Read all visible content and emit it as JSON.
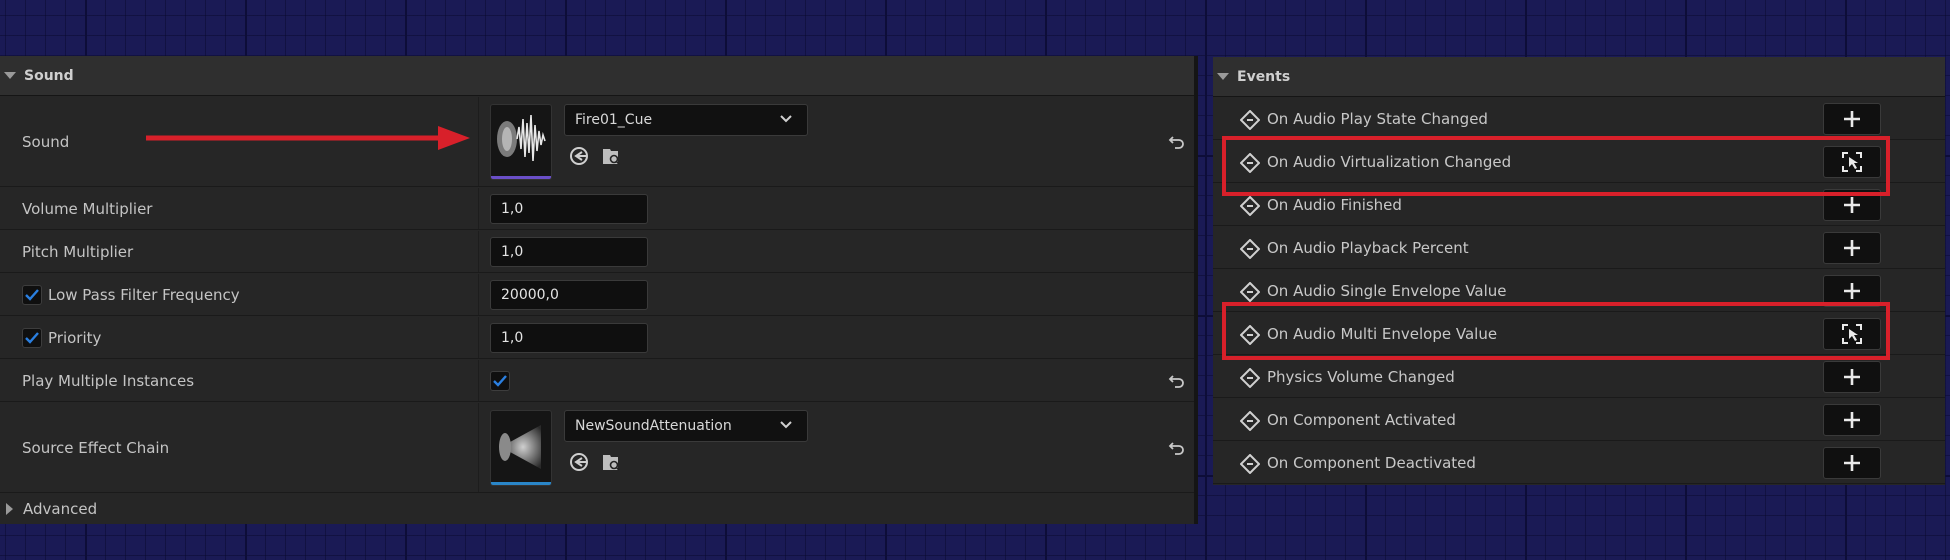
{
  "sound_panel": {
    "header": "Sound",
    "rows": {
      "sound": {
        "label": "Sound",
        "asset": "Fire01_Cue"
      },
      "volume": {
        "label": "Volume Multiplier",
        "value": "1,0"
      },
      "pitch": {
        "label": "Pitch Multiplier",
        "value": "1,0"
      },
      "low_pass": {
        "label": "Low Pass Filter Frequency",
        "value": "20000,0",
        "checked": true
      },
      "priority": {
        "label": "Priority",
        "value": "1,0",
        "checked": true
      },
      "play_multiple": {
        "label": "Play Multiple Instances",
        "checked": true
      },
      "source_effect": {
        "label": "Source Effect Chain",
        "asset": "NewSoundAttenuation"
      }
    },
    "advanced": "Advanced"
  },
  "events_panel": {
    "header": "Events",
    "items": [
      {
        "label": "On Audio Play State Changed",
        "button_icon": "plus-icon"
      },
      {
        "label": "On Audio Virtualization Changed",
        "button_icon": "open-event-icon",
        "highlighted": true
      },
      {
        "label": "On Audio Finished",
        "button_icon": "plus-icon"
      },
      {
        "label": "On Audio Playback Percent",
        "button_icon": "plus-icon"
      },
      {
        "label": "On Audio Single Envelope Value",
        "button_icon": "plus-icon"
      },
      {
        "label": "On Audio Multi Envelope Value",
        "button_icon": "open-event-icon",
        "highlighted": true
      },
      {
        "label": "Physics Volume Changed",
        "button_icon": "plus-icon"
      },
      {
        "label": "On Component Activated",
        "button_icon": "plus-icon"
      },
      {
        "label": "On Component Deactivated",
        "button_icon": "plus-icon"
      }
    ]
  },
  "colors": {
    "annotation_red": "#d8202a",
    "check_blue": "#2a7fe0",
    "sound_cue_bar": "#6a4fc8",
    "attenuation_bar": "#2a86c8"
  }
}
